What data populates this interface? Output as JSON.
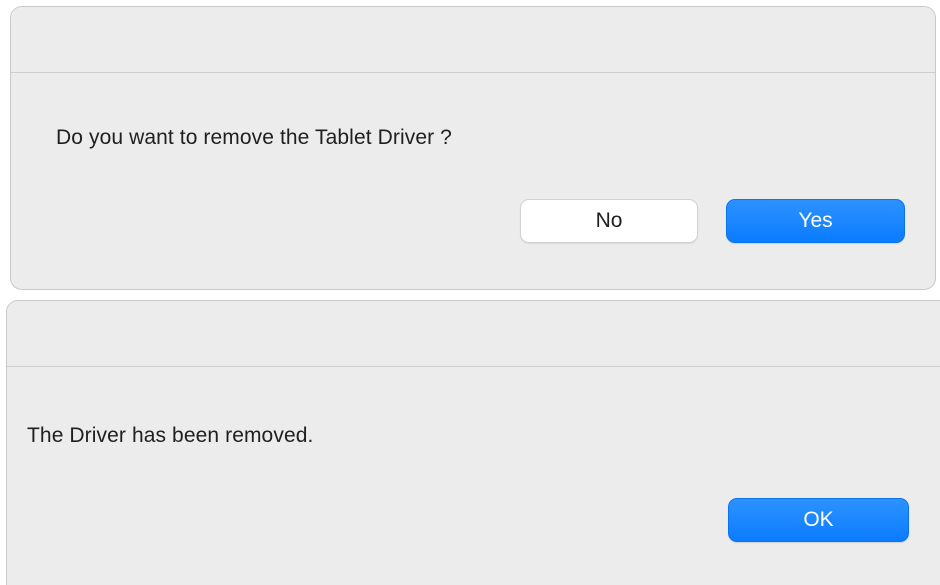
{
  "remove_dialog": {
    "message": "Do you want to remove the Tablet Driver ?",
    "no_label": "No",
    "yes_label": "Yes"
  },
  "removed_dialog": {
    "message": "The Driver has been removed.",
    "ok_label": "OK"
  },
  "colors": {
    "dialog_background": "#ececec",
    "primary_button": "#0a7cff",
    "secondary_button": "#ffffff",
    "text": "#1f1f1f"
  }
}
